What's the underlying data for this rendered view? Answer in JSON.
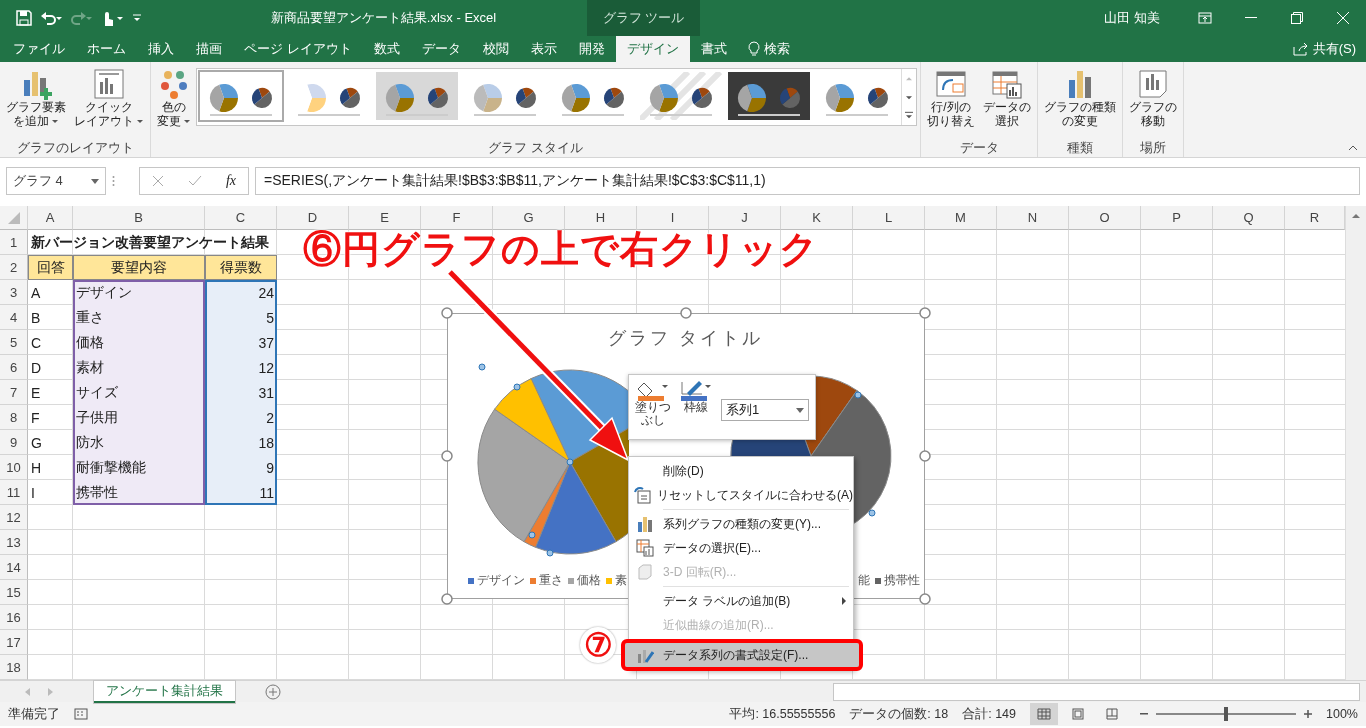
{
  "window": {
    "title": "新商品要望アンケート結果.xlsx  -  Excel",
    "context_label": "グラフ ツール",
    "user": "山田 知美"
  },
  "tabs": [
    {
      "label": "ファイル",
      "selected": false
    },
    {
      "label": "ホーム",
      "selected": false
    },
    {
      "label": "挿入",
      "selected": false
    },
    {
      "label": "描画",
      "selected": false
    },
    {
      "label": "ページ レイアウト",
      "selected": false
    },
    {
      "label": "数式",
      "selected": false
    },
    {
      "label": "データ",
      "selected": false
    },
    {
      "label": "校閲",
      "selected": false
    },
    {
      "label": "表示",
      "selected": false
    },
    {
      "label": "開発",
      "selected": false
    },
    {
      "label": "デザイン",
      "selected": true
    },
    {
      "label": "書式",
      "selected": false
    }
  ],
  "search": {
    "label": "検索"
  },
  "share": {
    "label": "共有(S)"
  },
  "ribbon": {
    "groups": [
      {
        "title": "グラフのレイアウト",
        "buttons": [
          {
            "lines": [
              "グラフ要素",
              "を追加"
            ],
            "dropdown": true
          },
          {
            "lines": [
              "クイック",
              "レイアウト"
            ],
            "dropdown": true
          }
        ]
      },
      {
        "title": "グラフ スタイル",
        "buttons": [
          {
            "lines": [
              "色の",
              "変更"
            ],
            "dropdown": true
          }
        ],
        "styles": [
          {
            "selected": true
          },
          {
            "selected": false
          },
          {
            "selected": false
          },
          {
            "selected": false
          },
          {
            "selected": false
          },
          {
            "selected": false
          },
          {
            "selected": false
          },
          {
            "selected": false
          }
        ]
      },
      {
        "title": "データ",
        "buttons": [
          {
            "lines": [
              "行/列の",
              "切り替え"
            ],
            "dropdown": false
          },
          {
            "lines": [
              "データの",
              "選択"
            ],
            "dropdown": false
          }
        ]
      },
      {
        "title": "種類",
        "buttons": [
          {
            "lines": [
              "グラフの種類",
              "の変更"
            ],
            "dropdown": false
          }
        ]
      },
      {
        "title": "場所",
        "buttons": [
          {
            "lines": [
              "グラフの",
              "移動"
            ],
            "dropdown": false
          }
        ]
      }
    ]
  },
  "formula_bar": {
    "name_box": "グラフ 4",
    "function_label": "fx",
    "formula": "=SERIES(,アンケート集計結果!$B$3:$B$11,アンケート集計結果!$C$3:$C$11,1)"
  },
  "sheet": {
    "columns": [
      "A",
      "B",
      "C",
      "D",
      "E",
      "F",
      "G",
      "H",
      "I",
      "J",
      "K",
      "L",
      "M",
      "N",
      "O",
      "P",
      "Q",
      "R"
    ],
    "rows": [
      {
        "number": "1",
        "kind": "title",
        "cells": [
          "新バージョン改善要望アンケート結果"
        ]
      },
      {
        "number": "2",
        "kind": "header",
        "cells": [
          "回答",
          "要望内容",
          "得票数"
        ]
      },
      {
        "number": "3",
        "kind": "data",
        "cells": [
          "A",
          "デザイン",
          "24"
        ]
      },
      {
        "number": "4",
        "kind": "data",
        "cells": [
          "B",
          "重さ",
          "5"
        ]
      },
      {
        "number": "5",
        "kind": "data",
        "cells": [
          "C",
          "価格",
          "37"
        ]
      },
      {
        "number": "6",
        "kind": "data",
        "cells": [
          "D",
          "素材",
          "12"
        ]
      },
      {
        "number": "7",
        "kind": "data",
        "cells": [
          "E",
          "サイズ",
          "31"
        ]
      },
      {
        "number": "8",
        "kind": "data",
        "cells": [
          "F",
          "子供用",
          "2"
        ]
      },
      {
        "number": "9",
        "kind": "data",
        "cells": [
          "G",
          "防水",
          "18"
        ]
      },
      {
        "number": "10",
        "kind": "data",
        "cells": [
          "H",
          "耐衝撃機能",
          "9"
        ]
      },
      {
        "number": "11",
        "kind": "data",
        "cells": [
          "I",
          "携帯性",
          "11"
        ]
      },
      {
        "number": "12",
        "kind": "empty"
      },
      {
        "number": "13",
        "kind": "empty"
      },
      {
        "number": "14",
        "kind": "empty"
      },
      {
        "number": "15",
        "kind": "empty"
      },
      {
        "number": "16",
        "kind": "empty"
      },
      {
        "number": "17",
        "kind": "empty"
      },
      {
        "number": "18",
        "kind": "empty"
      }
    ]
  },
  "chart": {
    "title": "グラフ タイトル",
    "legend_left": [
      {
        "label": "デザイン",
        "color": "#4472c4"
      },
      {
        "label": "重さ",
        "color": "#ed7d31"
      },
      {
        "label": "価格",
        "color": "#a5a5a5"
      },
      {
        "label": "素",
        "color": "#ffc000"
      }
    ],
    "legend_right": [
      {
        "label": "能"
      },
      {
        "label": "携帯性",
        "color": "#636363"
      }
    ]
  },
  "mini_toolbar": {
    "fill_label": "塗りつぶし",
    "outline_label": "枠線",
    "series": "系列1"
  },
  "context_menu": [
    {
      "kind": "item",
      "label": "削除(D)",
      "disabled": false,
      "selected": false
    },
    {
      "kind": "item",
      "label": "リセットしてスタイルに合わせる(A)",
      "disabled": false,
      "selected": false
    },
    {
      "kind": "separator"
    },
    {
      "kind": "item",
      "label": "系列グラフの種類の変更(Y)...",
      "disabled": false,
      "selected": false
    },
    {
      "kind": "item",
      "label": "データの選択(E)...",
      "disabled": false,
      "selected": false
    },
    {
      "kind": "item",
      "label": "3-D 回転(R)...",
      "disabled": true,
      "selected": false
    },
    {
      "kind": "separator"
    },
    {
      "kind": "submenu",
      "label": "データ ラベルの追加(B)",
      "disabled": false,
      "selected": false
    },
    {
      "kind": "item",
      "label": "近似曲線の追加(R)...",
      "disabled": true,
      "selected": false
    },
    {
      "kind": "item",
      "label": "データ系列の書式設定(F)...",
      "disabled": false,
      "selected": true
    }
  ],
  "annotations": {
    "step6": "⑥円グラフの上で右クリック",
    "step7": "⑦"
  },
  "sheet_tabs": [
    {
      "label": "アンケート集計結果",
      "selected": true
    }
  ],
  "status_bar": {
    "status": "準備完了",
    "average": "平均: 16.55555556",
    "count": "データの個数: 18",
    "sum": "合計: 149",
    "views": [
      {
        "selected": true
      },
      {
        "selected": false
      },
      {
        "selected": false
      }
    ],
    "zoom": {
      "level": 0.5,
      "reading": "100%"
    }
  }
}
